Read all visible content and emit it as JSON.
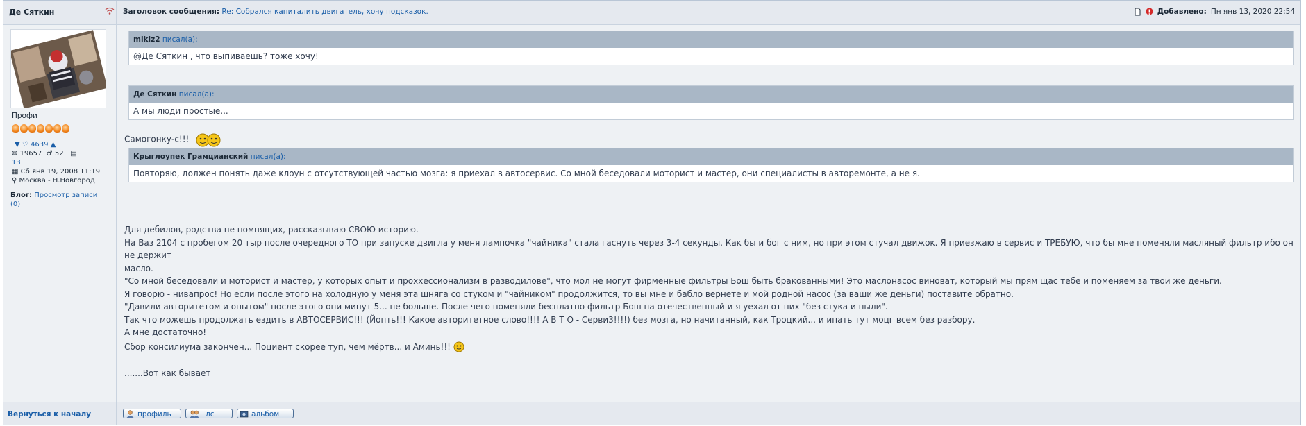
{
  "header": {
    "author": "Де Сяткин",
    "subject_label": "Заголовок сообщения:",
    "subject_link": "Re: Собрался капиталить двигатель, хочу подсказок.",
    "posted_label": "Добавлено:",
    "posted_date": "Пн янв 13, 2020 22:54"
  },
  "profile": {
    "rank": "Профи",
    "likes_count": "4639",
    "posts": "19657",
    "gender_count": "52",
    "album_count": "13",
    "registered": "Сб янв 19, 2008 11:19",
    "location": "Москва - Н.Новгород",
    "blog_label": "Блог:",
    "blog_link": "Просмотр записи",
    "blog_count": "(0)"
  },
  "quotes": [
    {
      "author": "mikiz2",
      "wrote": "писал(а):",
      "text": "@Де Сяткин , что выпиваешь? тоже хочу!"
    },
    {
      "author": "Де Сяткин",
      "wrote": "писал(а):",
      "text": "А мы люди простые..."
    },
    {
      "author": "Крыглоупек Грамцианский",
      "wrote": "писал(а):",
      "text": "Повторяю, должен понять даже клоун с отсутствующей частью мозга: я приехал в автосервис. Со мной беседовали моторист и мастер, они специалисты в авторемонте, а не я."
    }
  ],
  "reply_text": "Самогонку-с!!!",
  "body_lines": [
    "Для дебилов, родства не помнящих, рассказываю СВОЮ историю.",
    "На Ваз 2104 с пробегом 20 тыр после очередного ТО при запуске двигла у меня лампочка \"чайника\" стала гаснуть через 3-4 секунды. Как бы и бог с ним, но при этом стучал движок. Я приезжаю в сервис и ТРЕБУЮ, что бы мне поменяли масляный фильтр ибо он не держит",
    "масло.",
    "\"Со мной беседовали и моторист и мастер, у которых опыт и прохxессионализм в разводилове\", что мол не могут фирменные фильтры Бош быть бракованными! Это маслонасос виноват, который мы прям щас тебе и поменяем за твои же деньги.",
    "Я говорю - нивапрос! Но если после этого на холодную у меня эта шняга со стуком и \"чайником\" продолжится, то вы мне и бабло вернете и мой родной насос (за ваши же деньги) поставите обратно.",
    "\"Давили авторитетом и опытом\" после этого они минут 5... не больше. После чего поменяли бесплатно фильтр Бош на отечественный и я уехал от них \"без стука и пыли\".",
    "Так что можешь продолжать ездить в АВТОСЕРВИС!!! (Йопть!!! Какое авторитетное слово!!!! А В Т О - Серви3!!!!) без мозга, но начитанный, как Троцкий... и ипать тут моцг всем без разбору.",
    "А мне достаточно!",
    "Сбор консилиума закончен... Поциент скорее туп, чем мёртв... и Аминь!!!"
  ],
  "signature": ".......Вот как бывает",
  "footer": {
    "back_link": "Вернуться к началу",
    "profile_btn": "профиль",
    "pm_btn": "лс",
    "album_btn": "альбом"
  }
}
